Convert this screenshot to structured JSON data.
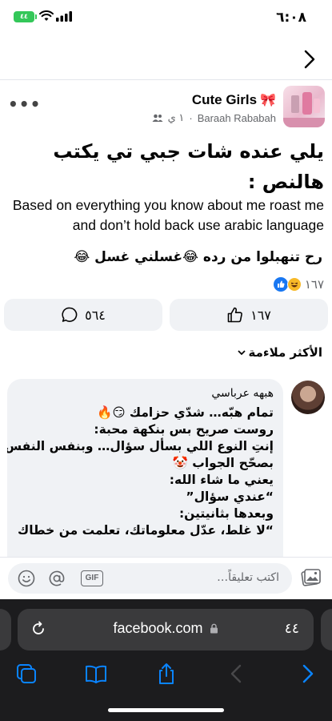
{
  "status_bar": {
    "time": "٦:٠٨",
    "battery": "٤٤"
  },
  "post": {
    "group_name": "Cute Girls",
    "author": "Baraah Rababah",
    "time_ago": "١ ي",
    "title": "يلي عنده شات جبي تي يكتب هالنص :",
    "english_text": "Based on everything you know about me roast me and don’t hold back use arabic language",
    "note": "رح تنهبلوا من رده 😂غسلني غسل 😂",
    "reaction_count": "١٦٧",
    "like_count": "١٦٧",
    "comment_count": "٥٦٤"
  },
  "comments": {
    "sort_label": "الأكثر ملاءمة",
    "items": [
      {
        "author": "هبهه عرباسي",
        "lines": [
          "تمام هبّه… شدّي حزامك 😏🔥",
          "روست صريح بس بنكهة محبة:",
          "إنتِ النوع اللي بسأل سؤال… وبنفس النفس",
          "بصحّح الجواب 🤡",
          "يعني ما شاء الله:",
          "“عندي سؤال”",
          "وبعدها بثانيتين:",
          "“لا غلط، عدّل معلوماتك، تعلمت من خطاك"
        ]
      }
    ],
    "composer_placeholder": "اكتب تعليقاً…"
  },
  "browser": {
    "url": "facebook.com",
    "aa_label": "٤٤"
  },
  "icons": {
    "wifi": "wifi-icon",
    "signal": "signal-icon",
    "back": "chevron-right-icon",
    "more": "more-dots-icon",
    "friends": "friends-icon",
    "like": "thumbs-up-icon",
    "comment": "comment-bubble-icon",
    "smile": "emoji-icon",
    "at": "mention-icon",
    "gif": "gif-icon",
    "photo": "photo-icon",
    "reload": "reload-icon",
    "lock": "lock-icon",
    "tabs": "tabs-icon",
    "bookmarks": "bookmarks-icon",
    "share": "share-icon",
    "back_nav": "back-arrow-icon",
    "forward_nav": "forward-arrow-icon"
  },
  "colors": {
    "accent": "#1877f2",
    "battery": "#34c759",
    "bubble": "#f0f2f5",
    "safari_bar": "#1c1c1e",
    "toolbar_icons": "#0a84ff"
  }
}
